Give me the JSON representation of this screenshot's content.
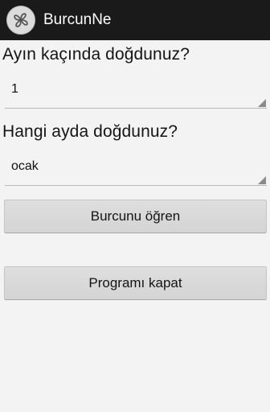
{
  "app": {
    "title": "BurcunNe",
    "icon": "app-logo-icon"
  },
  "form": {
    "day_question": "Ayın kaçında doğdunuz?",
    "day_value": "1",
    "month_question": "Hangi ayda doğdunuz?",
    "month_value": "ocak"
  },
  "buttons": {
    "find_label": "Burcunu öğren",
    "close_label": "Programı kapat"
  },
  "colors": {
    "action_bar": "#1a1a1a",
    "background": "#f3f3f3",
    "button": "#d9d9d9"
  }
}
